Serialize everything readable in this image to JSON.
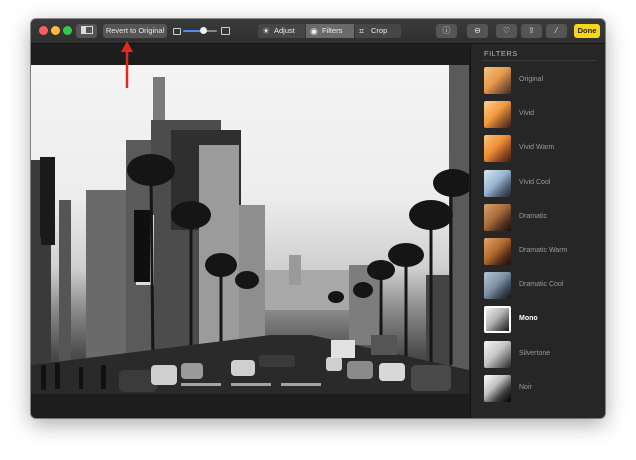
{
  "toolbar": {
    "revert_label": "Revert to Original",
    "zoom_level": 0.6,
    "tabs": [
      {
        "label": "Adjust",
        "icon": "sun-icon"
      },
      {
        "label": "Filters",
        "icon": "filters-icon",
        "selected": true
      },
      {
        "label": "Crop",
        "icon": "crop-icon"
      }
    ],
    "action_icons": [
      "info-icon",
      "remove-icon",
      "heart-icon",
      "share-icon",
      "magic-wand-icon"
    ],
    "done_label": "Done",
    "done_color": "#f8d61a"
  },
  "sidebar": {
    "title": "FILTERS",
    "items": [
      {
        "label": "Original",
        "style": "color"
      },
      {
        "label": "Vivid",
        "style": "vivid"
      },
      {
        "label": "Vivid Warm",
        "style": "warm"
      },
      {
        "label": "Vivid Cool",
        "style": "cool"
      },
      {
        "label": "Dramatic",
        "style": "dramatic"
      },
      {
        "label": "Dramatic Warm",
        "style": "dramaticwarm"
      },
      {
        "label": "Dramatic Cool",
        "style": "dramaticcool"
      },
      {
        "label": "Mono",
        "style": "mono",
        "selected": true
      },
      {
        "label": "Silvertone",
        "style": "silver"
      },
      {
        "label": "Noir",
        "style": "noir"
      }
    ]
  },
  "annotation": {
    "arrow_color": "#e12a1f"
  }
}
